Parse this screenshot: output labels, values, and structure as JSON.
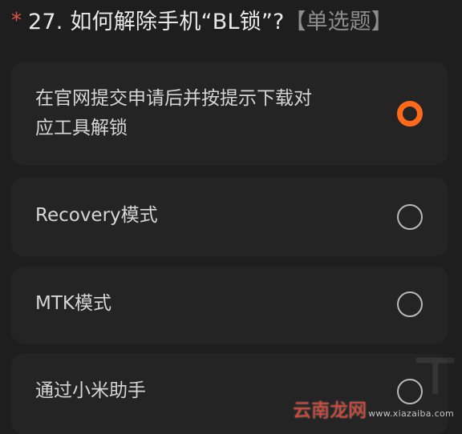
{
  "question": {
    "required_mark": "*",
    "title": "27. 如何解除手机“BL锁”?",
    "type_label": "【单选题】"
  },
  "options": [
    {
      "line1": "在官网提交申请后并按提示下载对",
      "line2": "应工具解锁",
      "selected": true
    },
    {
      "label": "Recovery模式",
      "selected": false
    },
    {
      "label": "MTK模式",
      "selected": false
    },
    {
      "label": "通过小米助手",
      "selected": false
    }
  ],
  "watermark": {
    "main": "云南龙网",
    "sub": "www.xiazaiba.com"
  },
  "colors": {
    "background": "#1e1e1f",
    "card": "#242425",
    "accent": "#ff6a1a",
    "required": "#e0574a"
  }
}
